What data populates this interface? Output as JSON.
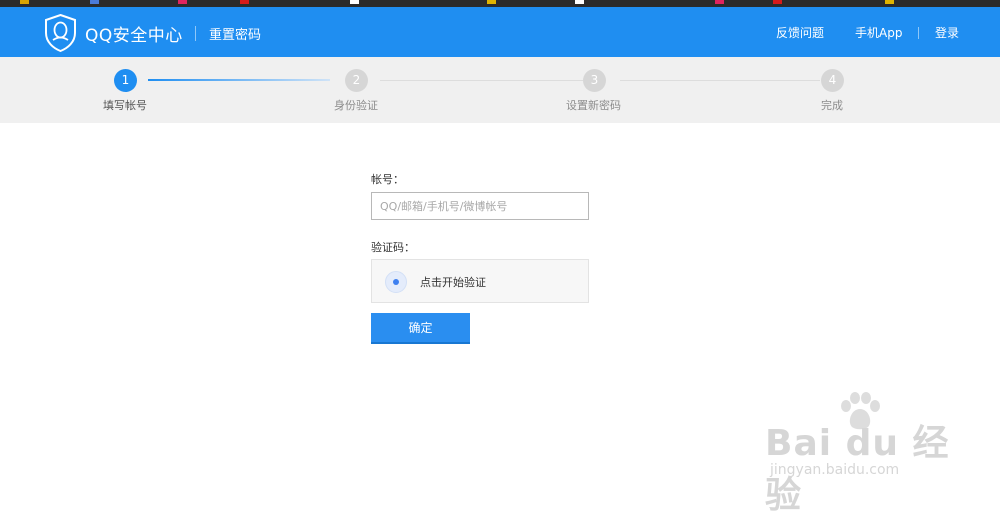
{
  "header": {
    "brand": "QQ安全中心",
    "subtitle": "重置密码",
    "nav": [
      "反馈问题",
      "手机App",
      "登录"
    ],
    "color": "#1f8ef1"
  },
  "steps": [
    {
      "num": "1",
      "label": "填写帐号",
      "active": true
    },
    {
      "num": "2",
      "label": "身份验证",
      "active": false
    },
    {
      "num": "3",
      "label": "设置新密码",
      "active": false
    },
    {
      "num": "4",
      "label": "完成",
      "active": false
    }
  ],
  "form": {
    "account_label": "帐号：",
    "account_placeholder": "QQ/邮箱/手机号/微博帐号",
    "account_value": "",
    "captcha_label": "验证码：",
    "captcha_text": "点击开始验证",
    "submit_label": "确定"
  },
  "watermark": {
    "brand": "Bai du 经验",
    "url": "jingyan.baidu.com"
  }
}
